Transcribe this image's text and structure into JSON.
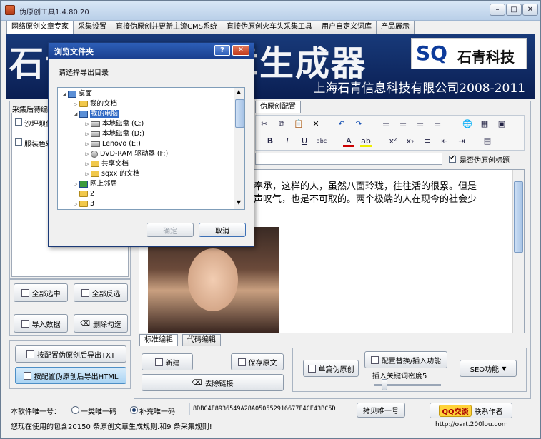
{
  "window": {
    "title": "伪原创工具1.4.80.20",
    "min_label": "–",
    "max_label": "□",
    "close_label": "✕"
  },
  "tabs": [
    "网络原创文章专家",
    "采集设置",
    "直接伪原创并更新主流CMS系统",
    "直接伪原创火车头采集工具",
    "用户自定义词库",
    "产品展示"
  ],
  "banner": {
    "headline": "石青伪原创文章生成器",
    "logo_sq": "SQ",
    "logo_company": "石青科技",
    "subtitle": "上海石青信息科技有限公司2008-2011"
  },
  "left_panel": {
    "group_title": "采集后待编",
    "items": [
      "沙坪坝供",
      "服装色彩"
    ],
    "buttons": {
      "select_all": "全部选中",
      "invert": "全部反选",
      "import": "导入数据",
      "delete_checked": "删除勾选",
      "export_txt": "按配置伪原创后导出TXT",
      "export_html": "按配置伪原创后导出HTML"
    }
  },
  "right_panel": {
    "config_tab": "伪原创配置",
    "checkbox_label": "是否伪原创标题",
    "editor_text_line1": "奉承，这样的人，虽然八面玲珑，往往活的很累。但是",
    "editor_text_line2": "声叹气，也是不可取的。两个极端的人在现今的社会少",
    "editor_tabs": [
      "标准编辑",
      "代码编辑"
    ],
    "buttons": {
      "new": "新建",
      "save": "保存原文",
      "remove_link": "去除链接",
      "single": "单篇伪原创",
      "config_replace": "配置替换/插入功能",
      "seo": "SEO功能"
    },
    "density_label": "插入关键词密度5"
  },
  "dialog": {
    "title": "浏览文件夹",
    "help_label": "?",
    "close_label": "✕",
    "prompt": "请选择导出目录",
    "tree": [
      "桌面",
      "我的文档",
      "我的电脑",
      "本地磁盘 (C:)",
      "本地磁盘 (D:)",
      "Lenovo (E:)",
      "DVD-RAM 驱动器 (F:)",
      "共享文档",
      "sqxx 的文档",
      "网上邻居",
      "2",
      "3"
    ],
    "ok_label": "确定",
    "cancel_label": "取消"
  },
  "status": {
    "unique_label": "本软件唯一号：",
    "radio1": "一类唯一码",
    "radio2": "补充唯一码",
    "code": "8DBC4F8936549A28A050552916677F4CE43BC5D",
    "copy_button": "拷贝唯一号",
    "qq_label": "QQ交谈",
    "contact": "联系作者",
    "rules_text": "您现在使用的包含20150 条原创文章生成规则.和9 条采集规则!",
    "url": "http://oart.200lou.com"
  },
  "colors": {
    "banner_bg": "#0a1e52",
    "dialog_title": "#1a3f8f",
    "highlight_button": "#a9d3f3"
  }
}
